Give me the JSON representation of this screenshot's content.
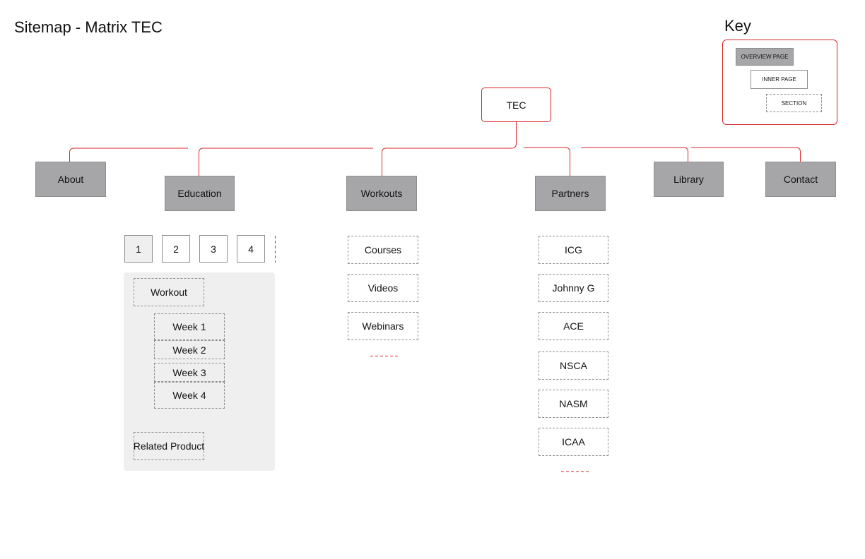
{
  "title": "Sitemap - Matrix TEC",
  "key": {
    "title": "Key",
    "overview_label": "OVERVIEW PAGE",
    "inner_label": "INNER PAGE",
    "section_label": "SECTION"
  },
  "root": "TEC",
  "nav": {
    "about": "About",
    "education": "Education",
    "workouts": "Workouts",
    "partners": "Partners",
    "library": "Library",
    "contact": "Contact"
  },
  "education": {
    "tabs": [
      "1",
      "2",
      "3",
      "4"
    ],
    "workout": "Workout",
    "weeks": [
      "Week 1",
      "Week 2",
      "Week 3",
      "Week 4"
    ],
    "related": "Related Product"
  },
  "workouts": {
    "items": [
      "Courses",
      "Videos",
      "Webinars"
    ]
  },
  "partners": {
    "items": [
      "ICG",
      "Johnny G",
      "ACE",
      "NSCA",
      "NASM",
      "ICAA"
    ]
  },
  "colors": {
    "connector": "#d9262b",
    "overview_fill": "#a6a6a8",
    "panel_fill": "#efefef"
  }
}
